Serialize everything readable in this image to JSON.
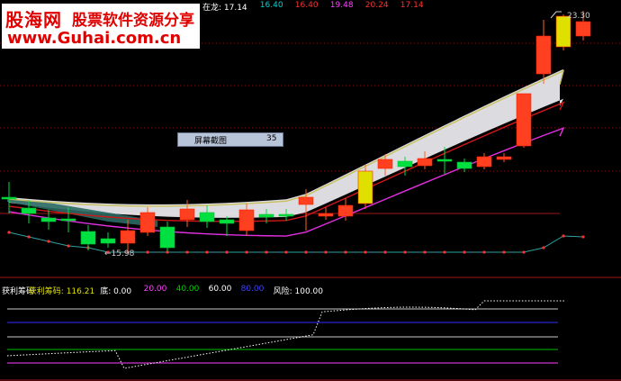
{
  "logo": {
    "name": "股海网",
    "slogan": "股票软件资源分享",
    "url": "www.Guhai.com.cn"
  },
  "top_header": [
    {
      "text": "在龙: 17.14",
      "color": "#ffffff"
    },
    {
      "text": "16.40",
      "color": "#00d0d0"
    },
    {
      "text": "16.40",
      "color": "#ff3030"
    },
    {
      "text": "19.48",
      "color": "#ff40ff"
    },
    {
      "text": "20.24",
      "color": "#ff3030"
    },
    {
      "text": "17.14",
      "color": "#ff3030"
    }
  ],
  "price_high_label": "23.30",
  "price_low_label": "←15.98",
  "tooltip": {
    "label": "屏幕截图",
    "value": "35"
  },
  "indicator_header": [
    {
      "text": "获利筹码",
      "color": "#ffffff"
    },
    {
      "text": "获利筹码: 116.21",
      "color": "#e0e000"
    },
    {
      "text": "底: 0.00",
      "color": "#ffffff"
    },
    {
      "text": "20.00",
      "color": "#ff40ff"
    },
    {
      "text": "40.00",
      "color": "#00d000"
    },
    {
      "text": "60.00",
      "color": "#ffffff"
    },
    {
      "text": "80.00",
      "color": "#4040ff"
    },
    {
      "text": "风险: 100.00",
      "color": "#ffffff"
    }
  ],
  "chart_data": {
    "type": "candlestick",
    "candles": [
      {
        "o": 219,
        "c": 219,
        "h": 202,
        "l": 237
      },
      {
        "o": 231,
        "c": 237,
        "h": 222,
        "l": 248
      },
      {
        "o": 242,
        "c": 246,
        "h": 233,
        "l": 255
      },
      {
        "o": 243,
        "c": 243,
        "h": 230,
        "l": 258
      },
      {
        "o": 257,
        "c": 271,
        "h": 250,
        "l": 278
      },
      {
        "o": 265,
        "c": 270,
        "h": 258,
        "l": 275
      },
      {
        "o": 270,
        "c": 256,
        "h": 244,
        "l": 278
      },
      {
        "o": 258,
        "c": 236,
        "h": 230,
        "l": 262
      },
      {
        "o": 252,
        "c": 275,
        "h": 246,
        "l": 279
      },
      {
        "o": 244,
        "c": 232,
        "h": 222,
        "l": 252
      },
      {
        "o": 236,
        "c": 246,
        "h": 228,
        "l": 253
      },
      {
        "o": 244,
        "c": 248,
        "h": 240,
        "l": 262
      },
      {
        "o": 256,
        "c": 233,
        "h": 226,
        "l": 262
      },
      {
        "o": 238,
        "c": 241,
        "h": 232,
        "l": 248
      },
      {
        "o": 238,
        "c": 238,
        "h": 232,
        "l": 245
      },
      {
        "o": 227,
        "c": 219,
        "h": 210,
        "l": 256
      },
      {
        "o": 240,
        "c": 237,
        "h": 230,
        "l": 244
      },
      {
        "o": 240,
        "c": 228,
        "h": 220,
        "l": 245
      },
      {
        "o": 226,
        "c": 190,
        "h": 183,
        "l": 232
      },
      {
        "o": 187,
        "c": 177,
        "h": 171,
        "l": 195
      },
      {
        "o": 179,
        "c": 185,
        "h": 174,
        "l": 195
      },
      {
        "o": 184,
        "c": 176,
        "h": 168,
        "l": 188
      },
      {
        "o": 177,
        "c": 177,
        "h": 163,
        "l": 193
      },
      {
        "o": 180,
        "c": 187,
        "h": 176,
        "l": 191
      },
      {
        "o": 185,
        "c": 174,
        "h": 170,
        "l": 188
      },
      {
        "o": 177,
        "c": 174,
        "h": 170,
        "l": 180
      },
      {
        "o": 162,
        "c": 104,
        "h": 104,
        "l": 164
      },
      {
        "o": 82,
        "c": 40,
        "h": 22,
        "l": 93
      },
      {
        "o": 52,
        "c": 18,
        "h": 16,
        "l": 56
      },
      {
        "o": 40,
        "c": 24,
        "h": 12,
        "l": 45
      }
    ]
  }
}
